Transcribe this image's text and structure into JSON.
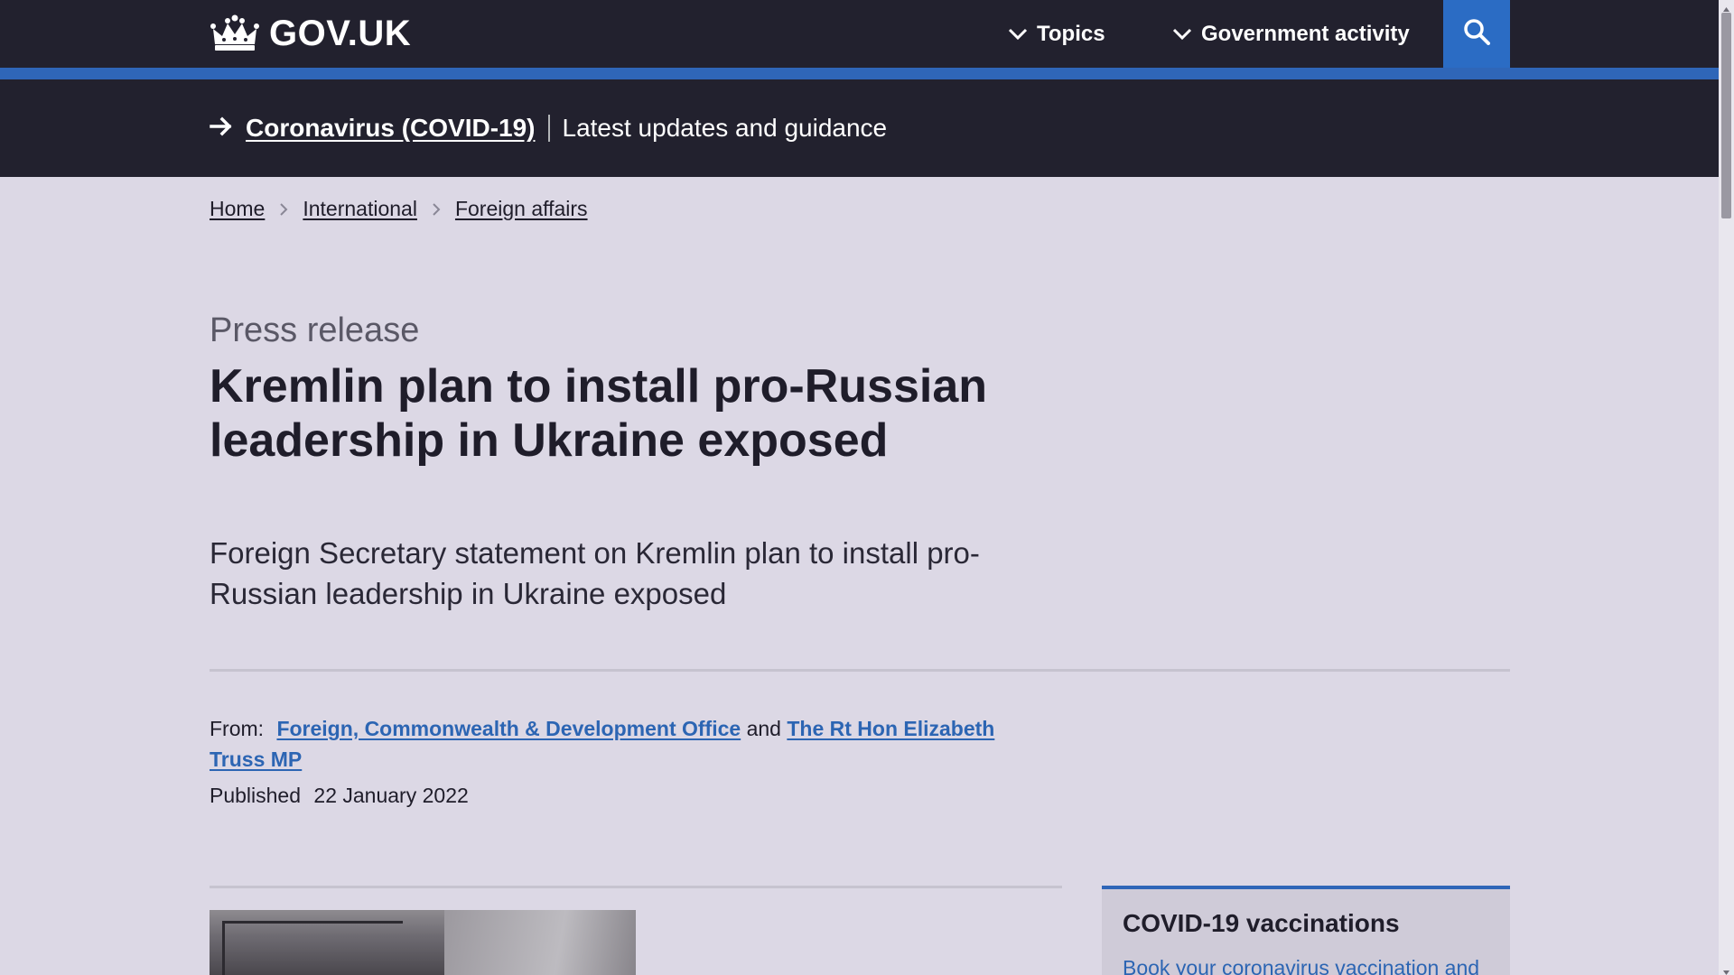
{
  "header": {
    "logo_text": "GOV.UK",
    "nav": [
      {
        "label": "Topics",
        "icon": "chevron-down-icon"
      },
      {
        "label": "Government activity",
        "icon": "chevron-down-icon"
      }
    ],
    "search_icon": "search-icon"
  },
  "covid_banner": {
    "link_label": "Coronavirus (COVID-19)",
    "description": "Latest updates and guidance"
  },
  "breadcrumbs": [
    "Home",
    "International",
    "Foreign affairs"
  ],
  "article": {
    "caption": "Press release",
    "title": "Kremlin plan to install pro-Russian leadership in Ukraine exposed",
    "lead": "Foreign Secretary statement on Kremlin plan to install pro-Russian leadership in Ukraine exposed",
    "from_label": "From:",
    "from_org_1": "Foreign, Commonwealth & Development Office",
    "from_joiner": "and",
    "from_org_2": "The Rt Hon Elizabeth Truss MP",
    "published_label": "Published",
    "published_date": "22 January 2022"
  },
  "sidebar": {
    "title": "COVID-19 vaccinations",
    "link_text": "Book your coronavirus vaccination and"
  },
  "colors": {
    "header_bg": "#22212e",
    "accent_blue": "#2f66b8",
    "link_blue": "#2c65b3",
    "page_bg": "#dcd8e5"
  }
}
